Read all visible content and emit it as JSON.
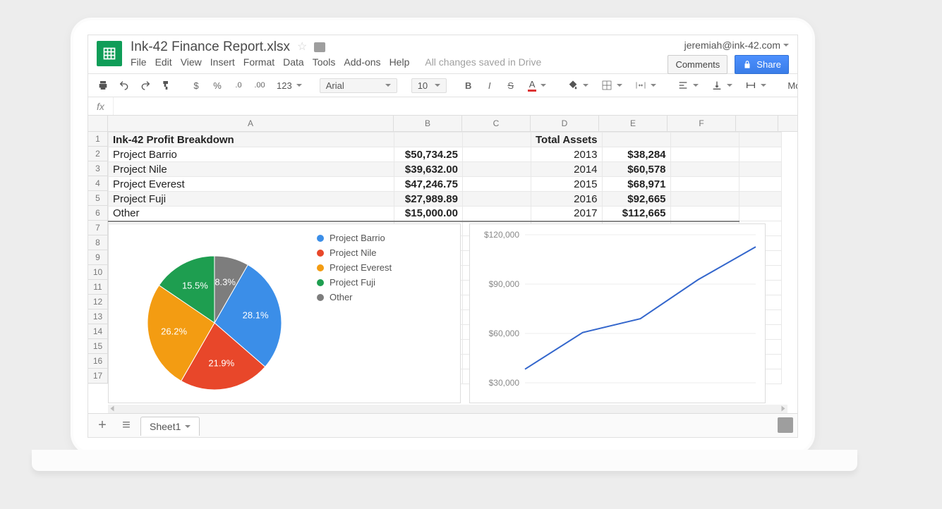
{
  "user": "jeremiah@ink-42.com",
  "title": "Ink-42 Finance Report.xlsx",
  "menus": [
    "File",
    "Edit",
    "View",
    "Insert",
    "Format",
    "Data",
    "Tools",
    "Add-ons",
    "Help"
  ],
  "save_msg": "All changes saved in Drive",
  "btn_comments": "Comments",
  "btn_share": "Share",
  "toolbar": {
    "font": "Arial",
    "size": "10",
    "num_group": [
      "$",
      "%",
      ".0",
      ".00",
      "123"
    ],
    "more": "More"
  },
  "columns": [
    "A",
    "B",
    "C",
    "D",
    "E",
    "F"
  ],
  "headers": {
    "a1": "Ink-42 Profit Breakdown",
    "d1": "Total Assets"
  },
  "profit": [
    {
      "name": "Project Barrio",
      "val": "$50,734.25"
    },
    {
      "name": "Project Nile",
      "val": "$39,632.00"
    },
    {
      "name": "Project Everest",
      "val": "$47,246.75"
    },
    {
      "name": "Project Fuji",
      "val": "$27,989.89"
    },
    {
      "name": "Other",
      "val": "$15,000.00"
    }
  ],
  "assets": [
    {
      "year": "2013",
      "val": "$38,284"
    },
    {
      "year": "2014",
      "val": "$60,578"
    },
    {
      "year": "2015",
      "val": "$68,971"
    },
    {
      "year": "2016",
      "val": "$92,665"
    },
    {
      "year": "2017",
      "val": "$112,665"
    }
  ],
  "line_y_ticks": [
    "$120,000",
    "$90,000",
    "$60,000",
    "$30,000"
  ],
  "sheet_tab": "Sheet1",
  "chart_data": [
    {
      "type": "pie",
      "title": "",
      "series": [
        {
          "name": "Project Barrio",
          "value": 50734.25,
          "pct": 28.1,
          "color": "#3b8ee8"
        },
        {
          "name": "Project Nile",
          "value": 39632.0,
          "pct": 21.9,
          "color": "#e8472a"
        },
        {
          "name": "Project Everest",
          "value": 47246.75,
          "pct": 26.2,
          "color": "#f39c12"
        },
        {
          "name": "Project Fuji",
          "value": 27989.89,
          "pct": 15.5,
          "color": "#1e9e50"
        },
        {
          "name": "Other",
          "value": 15000.0,
          "pct": 8.3,
          "color": "#7d7d7d"
        }
      ]
    },
    {
      "type": "line",
      "xlabel": "",
      "ylabel": "",
      "ylim": [
        30000,
        120000
      ],
      "categories": [
        "2013",
        "2014",
        "2015",
        "2016",
        "2017"
      ],
      "values": [
        38284,
        60578,
        68971,
        92665,
        112665
      ]
    }
  ]
}
